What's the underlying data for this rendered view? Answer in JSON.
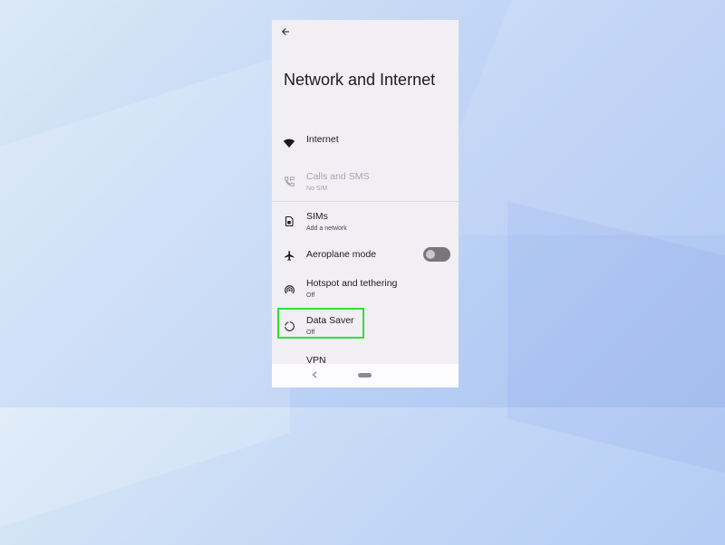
{
  "screen": {
    "title": "Network and Internet"
  },
  "settings": {
    "internet": {
      "title": "Internet",
      "subtitle": ""
    },
    "calls_sms": {
      "title": "Calls and SMS",
      "subtitle": "No SIM"
    },
    "sims": {
      "title": "SIMs",
      "subtitle": "Add a network"
    },
    "aeroplane": {
      "title": "Aeroplane mode",
      "toggle_on": false
    },
    "hotspot": {
      "title": "Hotspot and tethering",
      "subtitle": "Off"
    },
    "data_saver": {
      "title": "Data Saver",
      "subtitle": "Off"
    },
    "vpn": {
      "title": "VPN"
    }
  },
  "icons": {
    "back": "arrow-left-icon",
    "internet": "wifi-icon",
    "calls_sms": "phone-sms-icon",
    "sims": "sim-card-icon",
    "aeroplane": "airplane-icon",
    "hotspot": "hotspot-icon",
    "data_saver": "data-saver-icon",
    "vpn": "vpn-key-icon",
    "nav_back": "nav-back-icon",
    "nav_home": "nav-home-pill"
  },
  "colors": {
    "background_gradient_start": "#dbe9f7",
    "background_gradient_end": "#abc3f0",
    "phone_surface": "#f1eff4",
    "highlight": "#2ee135",
    "toggle_track_off": "#78767b",
    "text_primary": "#1d1b20",
    "text_disabled": "#a7a4ad"
  }
}
